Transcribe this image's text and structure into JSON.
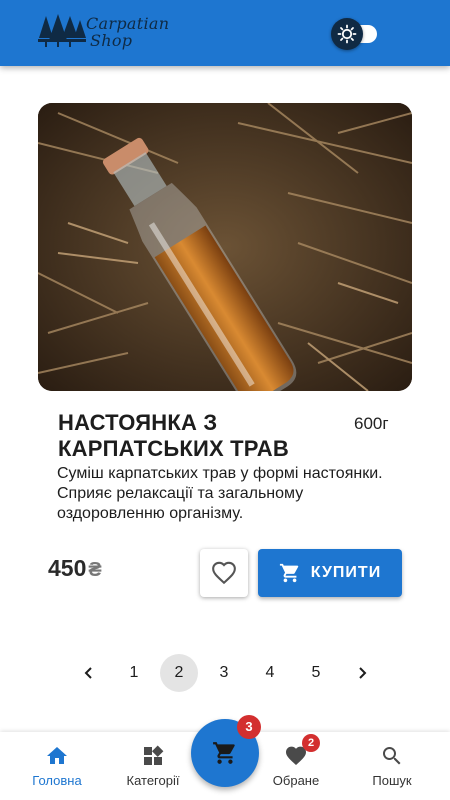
{
  "header": {
    "logo_line1": "Carpatian",
    "logo_line2": "Shop",
    "theme_icon": "sun-icon"
  },
  "product": {
    "image_icon": "liqueur-bottle-photo",
    "title": "НАСТОЯНКА З КАРПАТСЬКИХ ТРАВ",
    "weight": "600г",
    "description": "Суміш карпатських трав у формі настоянки. Сприяє релаксації та загальному оздоровленню організму.",
    "price": "450",
    "currency": "₴",
    "buy_label": "КУПИТИ"
  },
  "pagination": {
    "pages": [
      "1",
      "2",
      "3",
      "4",
      "5"
    ],
    "current": "2"
  },
  "bottom_nav": {
    "items": [
      {
        "label": "Головна",
        "icon": "home-icon"
      },
      {
        "label": "Категорії",
        "icon": "categories-icon"
      },
      {
        "label": "Обране",
        "icon": "heart-icon",
        "badge": "2"
      },
      {
        "label": "Пошук",
        "icon": "search-icon"
      }
    ],
    "cart_badge": "3"
  },
  "colors": {
    "primary": "#1e76d0",
    "header_dark": "#102a44",
    "badge": "#d32f2f"
  }
}
